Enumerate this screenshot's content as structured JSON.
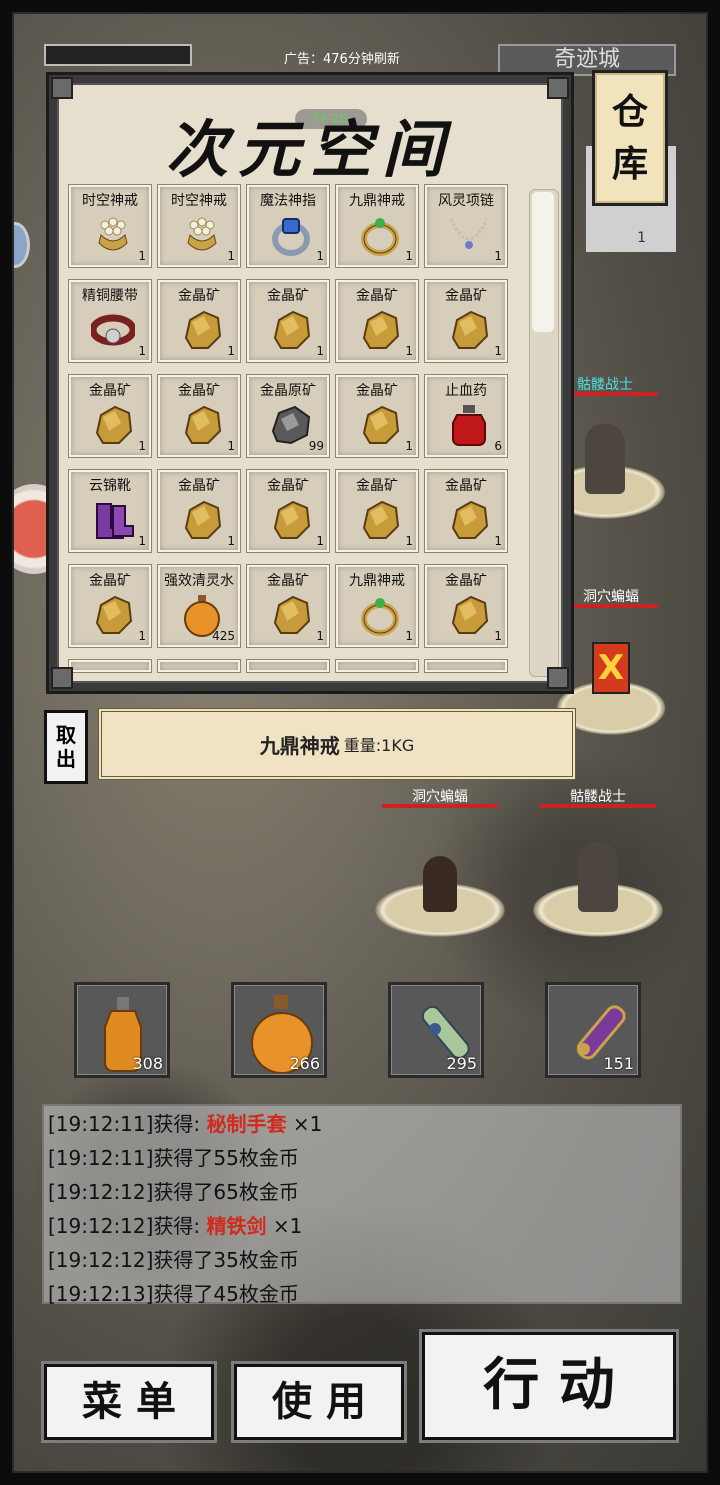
{
  "header": {
    "ad_text": "广告：476分钟刷新",
    "location": "奇迹城",
    "side_stat_value": "1"
  },
  "warehouse_button": {
    "line1": "仓",
    "line2": "库"
  },
  "storage": {
    "title": "次元空间",
    "title_badge": "FP 2G",
    "items": [
      {
        "name": "时空神戒",
        "count": "1",
        "icon": "pearl-ring-icon"
      },
      {
        "name": "时空神戒",
        "count": "1",
        "icon": "pearl-ring-icon"
      },
      {
        "name": "魔法神指",
        "count": "1",
        "icon": "blue-ring-icon"
      },
      {
        "name": "九鼎神戒",
        "count": "1",
        "icon": "gold-ring-icon"
      },
      {
        "name": "风灵项链",
        "count": "1",
        "icon": "necklace-icon"
      },
      {
        "name": "精铜腰带",
        "count": "1",
        "icon": "belt-icon"
      },
      {
        "name": "金晶矿",
        "count": "1",
        "icon": "gold-ore-icon"
      },
      {
        "name": "金晶矿",
        "count": "1",
        "icon": "gold-ore-icon"
      },
      {
        "name": "金晶矿",
        "count": "1",
        "icon": "gold-ore-icon"
      },
      {
        "name": "金晶矿",
        "count": "1",
        "icon": "gold-ore-icon"
      },
      {
        "name": "金晶矿",
        "count": "1",
        "icon": "gold-ore-icon"
      },
      {
        "name": "金晶矿",
        "count": "1",
        "icon": "gold-ore-icon"
      },
      {
        "name": "金晶原矿",
        "count": "99",
        "icon": "raw-ore-icon"
      },
      {
        "name": "金晶矿",
        "count": "1",
        "icon": "gold-ore-icon"
      },
      {
        "name": "止血药",
        "count": "6",
        "icon": "red-potion-icon"
      },
      {
        "name": "云锦靴",
        "count": "1",
        "icon": "boots-icon"
      },
      {
        "name": "金晶矿",
        "count": "1",
        "icon": "gold-ore-icon"
      },
      {
        "name": "金晶矿",
        "count": "1",
        "icon": "gold-ore-icon"
      },
      {
        "name": "金晶矿",
        "count": "1",
        "icon": "gold-ore-icon"
      },
      {
        "name": "金晶矿",
        "count": "1",
        "icon": "gold-ore-icon"
      },
      {
        "name": "金晶矿",
        "count": "1",
        "icon": "gold-ore-icon"
      },
      {
        "name": "强效清灵水",
        "count": "425",
        "icon": "orange-potion-icon"
      },
      {
        "name": "金晶矿",
        "count": "1",
        "icon": "gold-ore-icon"
      },
      {
        "name": "九鼎神戒",
        "count": "1",
        "icon": "gold-ring-icon"
      },
      {
        "name": "金晶矿",
        "count": "1",
        "icon": "gold-ore-icon"
      }
    ]
  },
  "selected": {
    "take_out_l1": "取",
    "take_out_l2": "出",
    "name": "九鼎神戒",
    "weight": "重量:1KG"
  },
  "close_label": "X",
  "monsters": [
    {
      "name": "骷髅战士",
      "color": "#4ee0e0"
    },
    {
      "name": "洞穴蝙蝠",
      "color": "#ffffff"
    },
    {
      "name": "洞穴蝙蝠",
      "color": "#ffffff"
    },
    {
      "name": "骷髅战士",
      "color": "#ffffff"
    }
  ],
  "quickbar": [
    {
      "count": "308",
      "icon": "small-orange-potion-icon"
    },
    {
      "count": "266",
      "icon": "large-orange-potion-icon"
    },
    {
      "count": "295",
      "icon": "green-scroll-icon"
    },
    {
      "count": "151",
      "icon": "purple-scroll-icon"
    }
  ],
  "log": [
    {
      "time": "[19:12:11]",
      "text": "获得: ",
      "item": "秘制手套",
      "suffix": " ×1"
    },
    {
      "time": "[19:12:11]",
      "text": "获得了55枚金币",
      "item": "",
      "suffix": ""
    },
    {
      "time": "[19:12:12]",
      "text": "获得了65枚金币",
      "item": "",
      "suffix": ""
    },
    {
      "time": "[19:12:12]",
      "text": "获得: ",
      "item": "精铁剑",
      "suffix": " ×1"
    },
    {
      "time": "[19:12:12]",
      "text": "获得了35枚金币",
      "item": "",
      "suffix": ""
    },
    {
      "time": "[19:12:13]",
      "text": "获得了45枚金币",
      "item": "",
      "suffix": ""
    }
  ],
  "buttons": {
    "menu": "菜 单",
    "use": "使 用",
    "action": "行 动"
  },
  "colors": {
    "highlight": "#d02b1e",
    "panel_bg": "#e6dfcd",
    "close_bg": "#d43a1c"
  }
}
